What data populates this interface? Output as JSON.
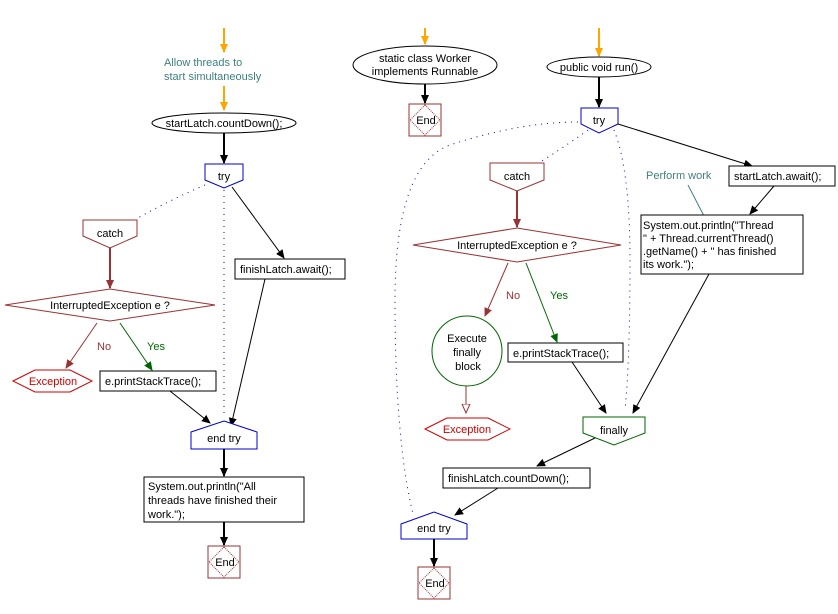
{
  "colors": {
    "entry_arrow": "#FFA500",
    "comment": "#408080",
    "try_block": "#0000CC",
    "catch_block": "#993333",
    "exception": "#CC0000",
    "yes": "#006600",
    "no": "#993333",
    "finally_block": "#006600",
    "end": "#993333",
    "line": "#000000"
  },
  "left_flow": {
    "comment": [
      "Allow threads to",
      "start simultaneously"
    ],
    "start": "startLatch.countDown();",
    "try": "try",
    "catch": "catch",
    "decision": "InterruptedException e ?",
    "no_label": "No",
    "yes_label": "Yes",
    "exception": "Exception",
    "catch_action": "e.printStackTrace();",
    "try_action": "finishLatch.await();",
    "end_try": "end try",
    "print": [
      "System.out.println(\"All",
      "threads have finished their",
      "work.\");"
    ],
    "end": "End"
  },
  "worker_class": {
    "title": [
      "static class Worker",
      "implements Runnable"
    ],
    "end": "End"
  },
  "run_flow": {
    "start": "public void run()",
    "try": "try",
    "catch": "catch",
    "decision": "InterruptedException e ?",
    "no_label": "No",
    "yes_label": "Yes",
    "finally_node": [
      "Execute",
      "finally",
      "block"
    ],
    "exception": "Exception",
    "catch_action": "e.printStackTrace();",
    "comment": "Perform work",
    "await": "startLatch.await();",
    "print": [
      "System.out.println(\"Thread",
      "\" + Thread.currentThread()",
      ".getName() + \" has finished",
      "its work.\");"
    ],
    "finally": "finally",
    "countdown": "finishLatch.countDown();",
    "end_try": "end try",
    "end": "End"
  }
}
